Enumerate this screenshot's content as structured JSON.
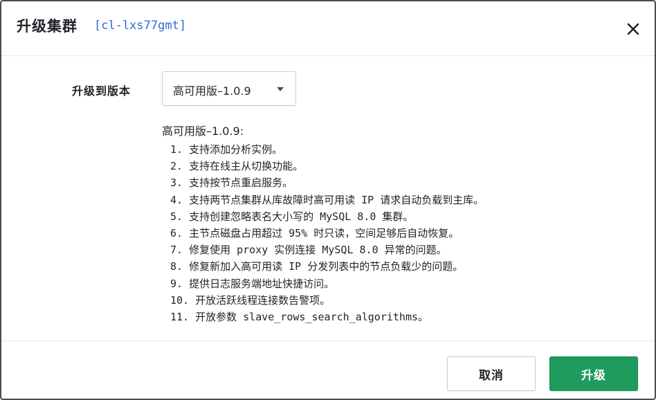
{
  "header": {
    "title": "升级集群",
    "cluster_id": "[cl-lxs77gmt]",
    "close_icon": "close-icon"
  },
  "form": {
    "version_label": "升级到版本",
    "version_select_value": "高可用版–1.0.9"
  },
  "changelog": {
    "title": "高可用版–1.0.9:",
    "items": [
      "1. 支持添加分析实例。",
      "2. 支持在线主从切换功能。",
      "3. 支持按节点重启服务。",
      "4. 支持两节点集群从库故障时高可用读 IP 请求自动负载到主库。",
      "5. 支持创建忽略表名大小写的 MySQL 8.0 集群。",
      "6. 主节点磁盘占用超过 95% 时只读，空间足够后自动恢复。",
      "7. 修复使用 proxy 实例连接 MySQL 8.0 异常的问题。",
      "8. 修复新加入高可用读 IP 分发列表中的节点负载少的问题。",
      "9. 提供日志服务端地址快捷访问。",
      "10. 开放活跃线程连接数告警项。",
      "11. 开放参数 slave_rows_search_algorithms。"
    ]
  },
  "footer": {
    "cancel_label": "取消",
    "submit_label": "升级"
  },
  "colors": {
    "primary": "#1f9b5e",
    "link": "#2f6bd6",
    "border": "#474c57"
  }
}
